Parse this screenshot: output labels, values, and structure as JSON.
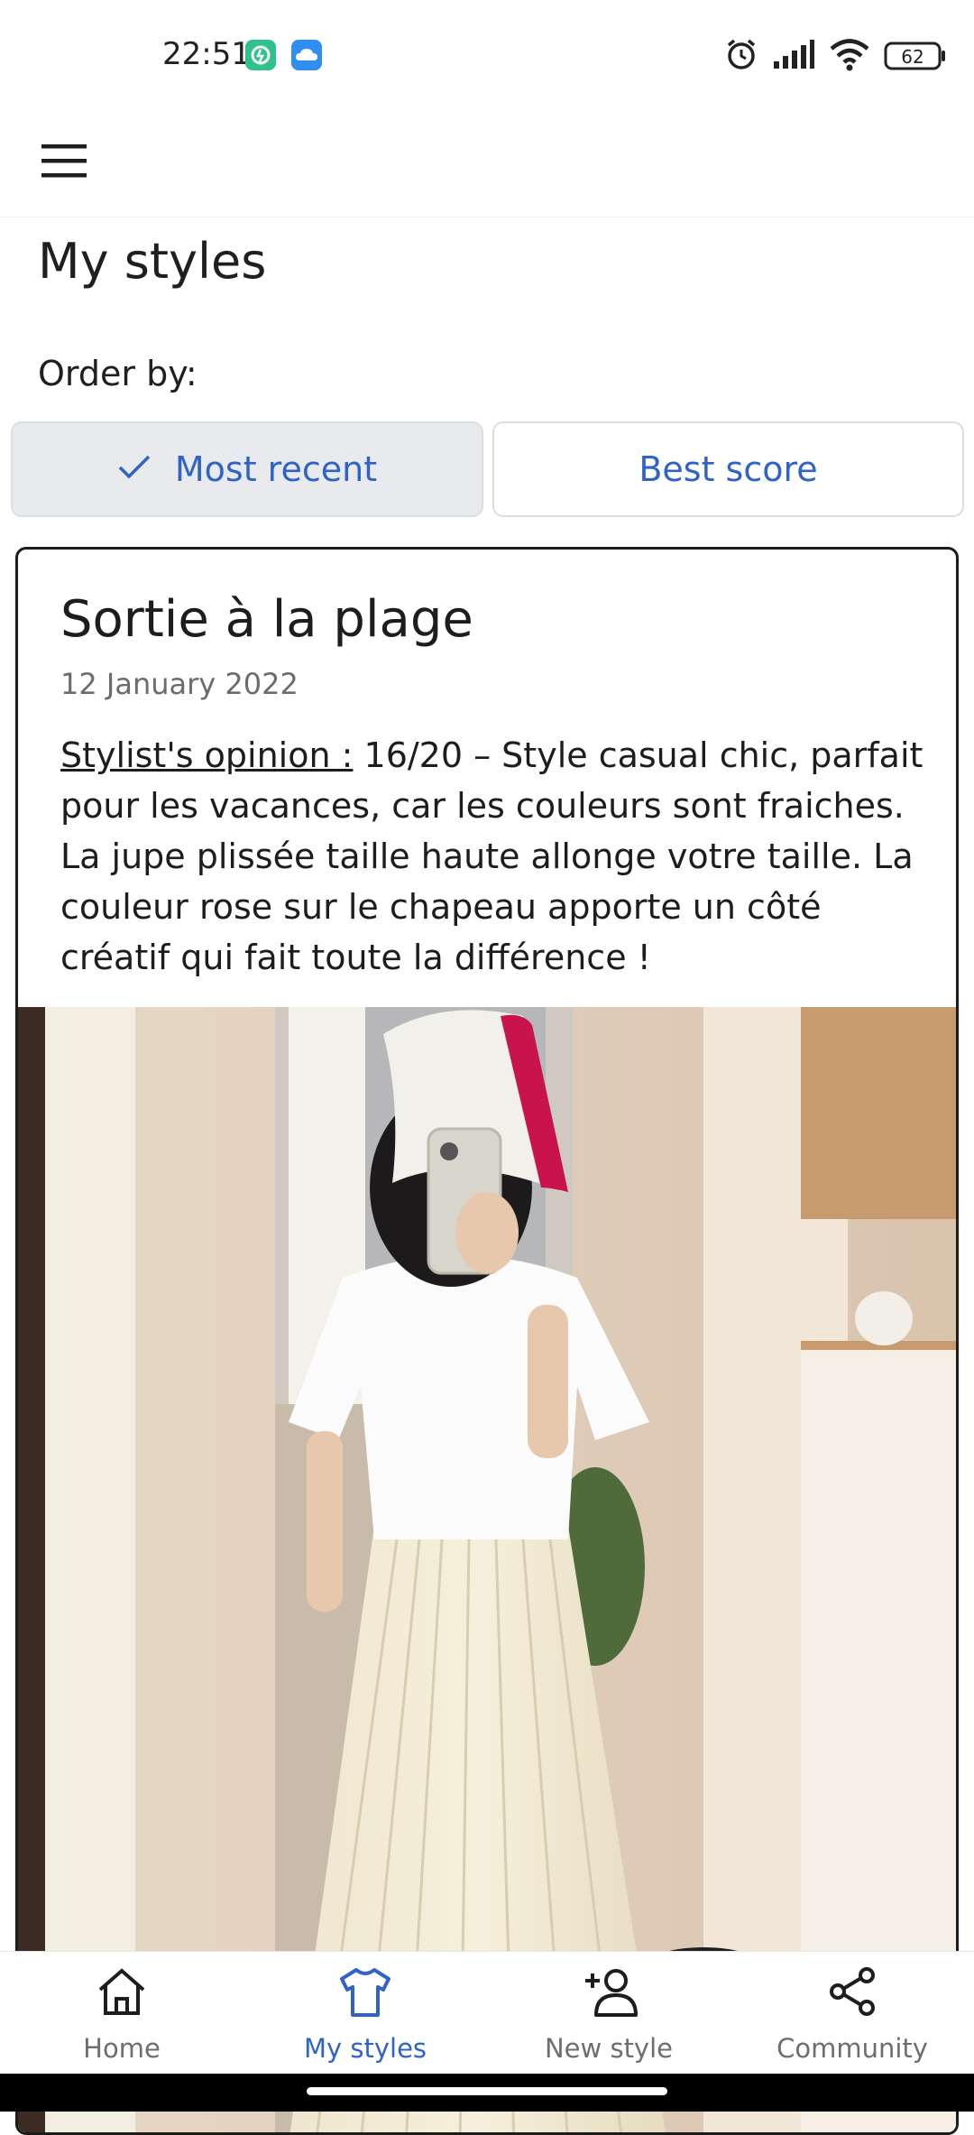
{
  "status_bar": {
    "time": "22:51",
    "battery": "62",
    "icons": [
      "app-notification-icon",
      "cloud-icon",
      "alarm-icon",
      "signal-icon",
      "wifi-icon",
      "battery-icon"
    ]
  },
  "header": {
    "menu_icon": "hamburger-menu-icon"
  },
  "page": {
    "title": "My styles",
    "order_label": "Order by:",
    "sort_options": [
      {
        "label": "Most recent",
        "selected": true
      },
      {
        "label": "Best score",
        "selected": false
      }
    ]
  },
  "card": {
    "title": "Sortie à la plage",
    "date": "12 January 2022",
    "opinion_label": "Stylist's opinion :",
    "opinion_text": " 16/20 – Style casual chic, parfait pour les vacances, car les couleurs sont fraiches. La jupe plissée taille haute allonge votre taille. La couleur rose sur le chapeau apporte un côté créatif qui fait toute la différence !"
  },
  "bottom_nav": [
    {
      "label": "Home",
      "icon": "home-icon",
      "active": false
    },
    {
      "label": "My styles",
      "icon": "tshirt-icon",
      "active": true
    },
    {
      "label": "New style",
      "icon": "add-person-icon",
      "active": false
    },
    {
      "label": "Community",
      "icon": "share-icon",
      "active": false
    }
  ],
  "colors": {
    "accent": "#2f63c8",
    "selected_bg": "#e9eaee",
    "border": "#d9dde4"
  }
}
